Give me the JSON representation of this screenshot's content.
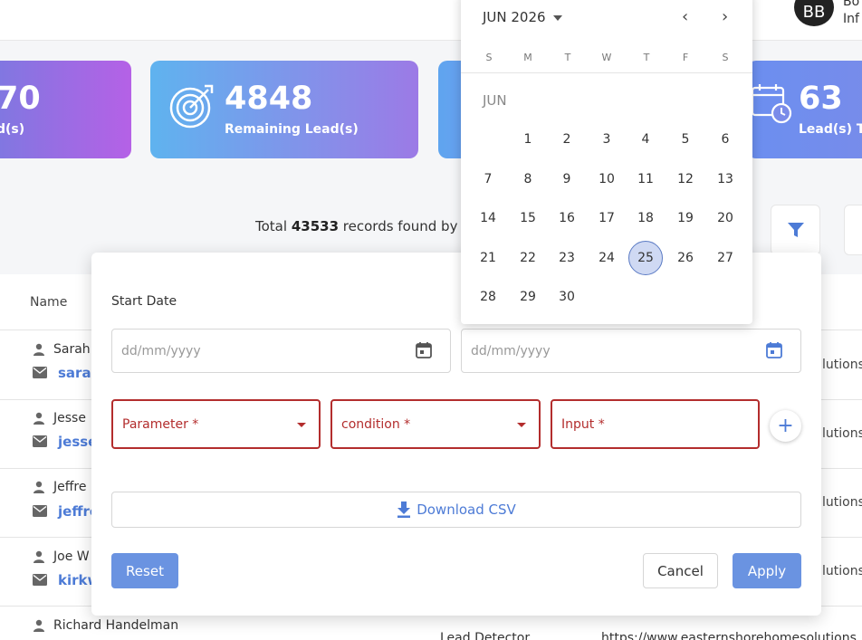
{
  "header": {
    "avatar_initials": "BB",
    "user_name": "Bo",
    "user_role": "Inf"
  },
  "cards": [
    {
      "value": "70",
      "label": "d(s)"
    },
    {
      "value": "4848",
      "label": "Remaining Lead(s)"
    },
    {
      "value": "",
      "label": ""
    },
    {
      "value": "63",
      "label": "Lead(s) Ti"
    }
  ],
  "summary": {
    "prefix": "Total",
    "count": "43533",
    "suffix": "records found by fil"
  },
  "table": {
    "name_header": "Name",
    "rows": [
      {
        "name": "Sarah",
        "email": "sarah",
        "extra": "lutions"
      },
      {
        "name": "Jesse",
        "email": "jesse",
        "extra": "lutions"
      },
      {
        "name": "Jeffre",
        "email": "jeffre",
        "extra": "lutions"
      },
      {
        "name": "Joe W",
        "email": "kirkw",
        "extra": "lutions"
      },
      {
        "name": "Richard Handelman",
        "source": "Lead Detector",
        "url": "https://www.easternshorehomesolutions"
      }
    ]
  },
  "filter_modal": {
    "start_date_label": "Start Date",
    "start_date_placeholder": "dd/mm/yyyy",
    "end_date_placeholder": "dd/mm/yyyy",
    "parameter_label": "Parameter *",
    "condition_label": "condition *",
    "input_label": "Input *",
    "add_label": "+",
    "download_label": "Download CSV",
    "reset_label": "Reset",
    "cancel_label": "Cancel",
    "apply_label": "Apply"
  },
  "calendar": {
    "header": "JUN 2026",
    "month_label": "JUN",
    "weekdays": [
      "S",
      "M",
      "T",
      "W",
      "T",
      "F",
      "S"
    ],
    "selected_day": "25",
    "weeks": [
      [
        "",
        "1",
        "2",
        "3",
        "4",
        "5",
        "6"
      ],
      [
        "7",
        "8",
        "9",
        "10",
        "11",
        "12",
        "13"
      ],
      [
        "14",
        "15",
        "16",
        "17",
        "18",
        "19",
        "20"
      ],
      [
        "21",
        "22",
        "23",
        "24",
        "25",
        "26",
        "27"
      ],
      [
        "28",
        "29",
        "30",
        "",
        "",
        "",
        ""
      ]
    ]
  },
  "colors": {
    "accent": "#6a93e1",
    "error": "#b32d2d",
    "link": "#4d7bd6"
  }
}
